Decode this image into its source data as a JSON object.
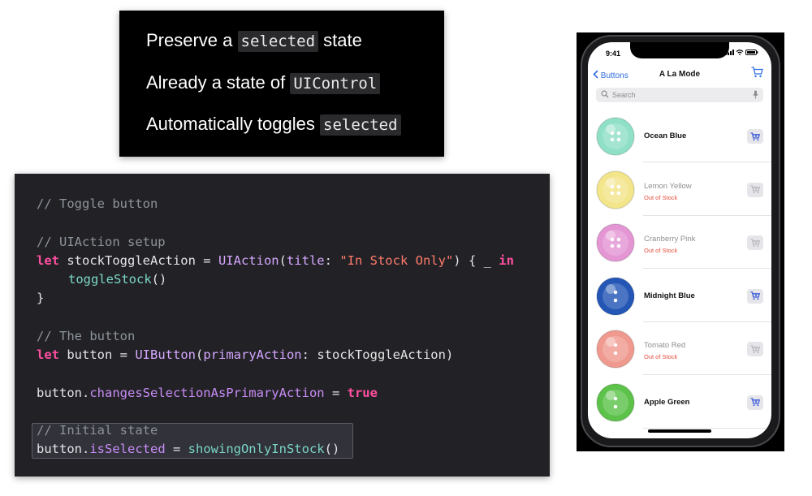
{
  "slide_bullets": [
    {
      "before": "Preserve a ",
      "code": "selected",
      "after": " state"
    },
    {
      "before": "Already a state of ",
      "code": "UIControl",
      "after": ""
    },
    {
      "before": "Automatically toggles ",
      "code": "selected",
      "after": ""
    }
  ],
  "code": {
    "comment_toggle": "// Toggle button",
    "comment_action": "// UIAction setup",
    "l3_let": "let",
    "l3_var": " stockToggleAction = ",
    "l3_type": "UIAction",
    "l3_open": "(",
    "l3_param": "title",
    "l3_colon": ": ",
    "l3_str": "\"In Stock Only\"",
    "l3_close": ") { _ ",
    "l3_in": "in",
    "l4_fn": "toggleStock",
    "l4_parens": "()",
    "l5_brace": "}",
    "comment_button": "// The button",
    "l7_let": "let",
    "l7_var": " button = ",
    "l7_type": "UIButton",
    "l7_open": "(",
    "l7_param": "primaryAction",
    "l7_rest": ": stockToggleAction)",
    "l9_obj": "button.",
    "l9_prop": "changesSelectionAsPrimaryAction",
    "l9_eq": " = ",
    "l9_true": "true",
    "comment_initial": "// Initial state",
    "l11_obj": "button.",
    "l11_prop": "isSelected",
    "l11_eq": " = ",
    "l11_fn": "showingOnlyInStock",
    "l11_parens": "()"
  },
  "phone": {
    "time": "9:41",
    "back_label": "Buttons",
    "title": "A La Mode",
    "search_placeholder": "Search",
    "items": [
      {
        "name": "Ocean Blue",
        "in_stock": true,
        "stock_text": "",
        "color": "#8fe0c6",
        "holes": 4
      },
      {
        "name": "Lemon Yellow",
        "in_stock": false,
        "stock_text": "Out of Stock",
        "color": "#f3e58a",
        "holes": 4
      },
      {
        "name": "Cranberry Pink",
        "in_stock": false,
        "stock_text": "Out of Stock",
        "color": "#e495d4",
        "holes": 4
      },
      {
        "name": "Midnight Blue",
        "in_stock": true,
        "stock_text": "",
        "color": "#2456b5",
        "holes": 2
      },
      {
        "name": "Tomato Red",
        "in_stock": false,
        "stock_text": "Out of Stock",
        "color": "#f09a8f",
        "holes": 2
      },
      {
        "name": "Apple Green",
        "in_stock": true,
        "stock_text": "",
        "color": "#5cc24a",
        "holes": 2
      }
    ]
  },
  "colors": {
    "accent_blue": "#2f6de0",
    "out_of_stock_red": "#e84c3d",
    "cart_enabled": "#3b5bd6",
    "cart_disabled": "#b8b8bd"
  }
}
